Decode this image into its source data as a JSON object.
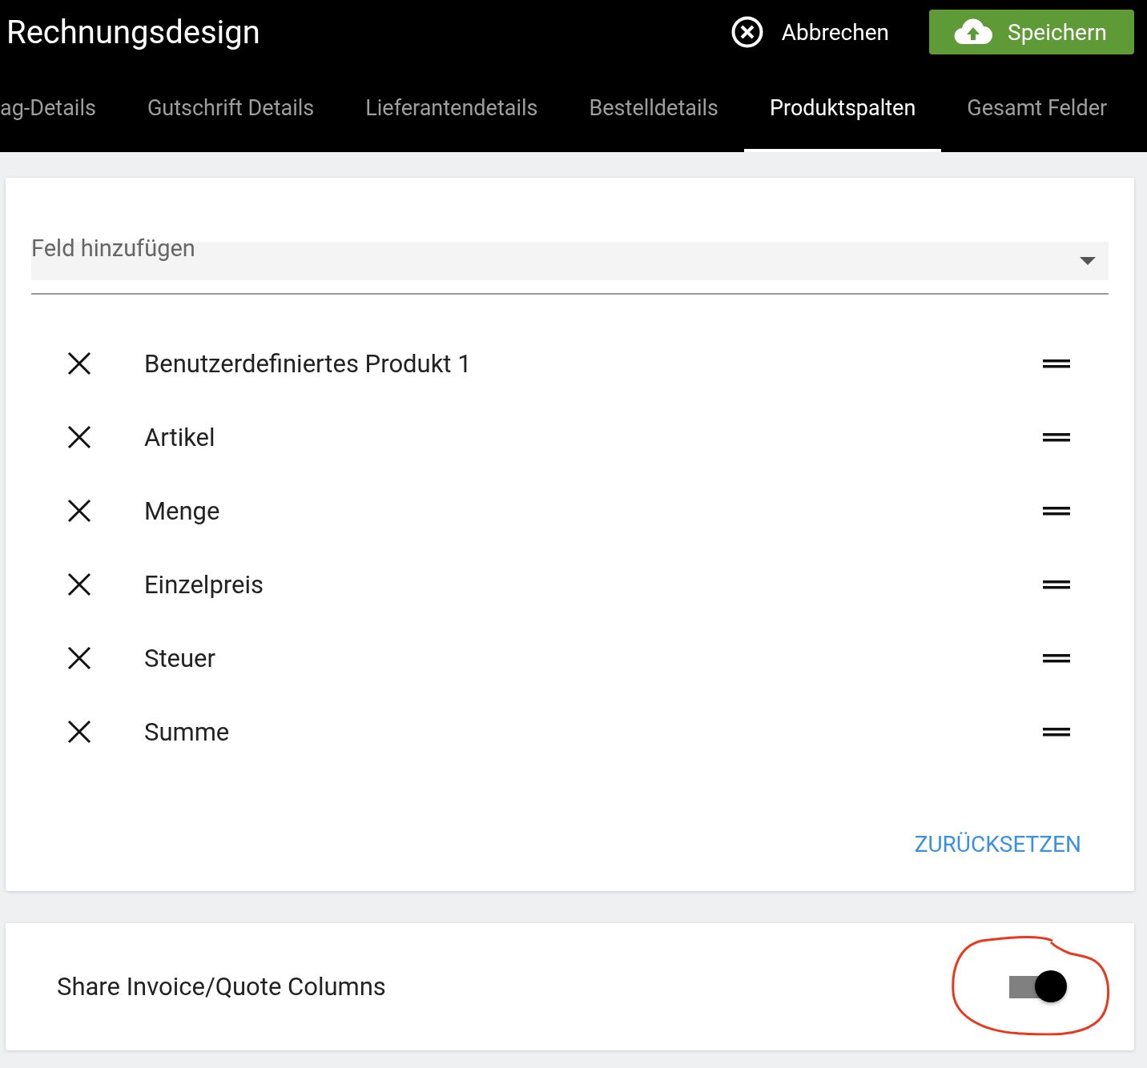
{
  "header": {
    "title": "Rechnungsdesign",
    "cancel_label": "Abbrechen",
    "save_label": "Speichern"
  },
  "tabs": [
    {
      "label": "ag-Details",
      "selected": false
    },
    {
      "label": "Gutschrift Details",
      "selected": false
    },
    {
      "label": "Lieferantendetails",
      "selected": false
    },
    {
      "label": "Bestelldetails",
      "selected": false
    },
    {
      "label": "Produktspalten",
      "selected": true
    },
    {
      "label": "Gesamt Felder",
      "selected": false
    }
  ],
  "field_select": {
    "placeholder": "Feld hinzufügen"
  },
  "columns": [
    {
      "label": "Benutzerdefiniertes Produkt 1"
    },
    {
      "label": "Artikel"
    },
    {
      "label": "Menge"
    },
    {
      "label": "Einzelpreis"
    },
    {
      "label": "Steuer"
    },
    {
      "label": "Summe"
    }
  ],
  "reset_label": "ZURÜCKSETZEN",
  "share_setting": {
    "label": "Share Invoice/Quote Columns",
    "on": true
  }
}
